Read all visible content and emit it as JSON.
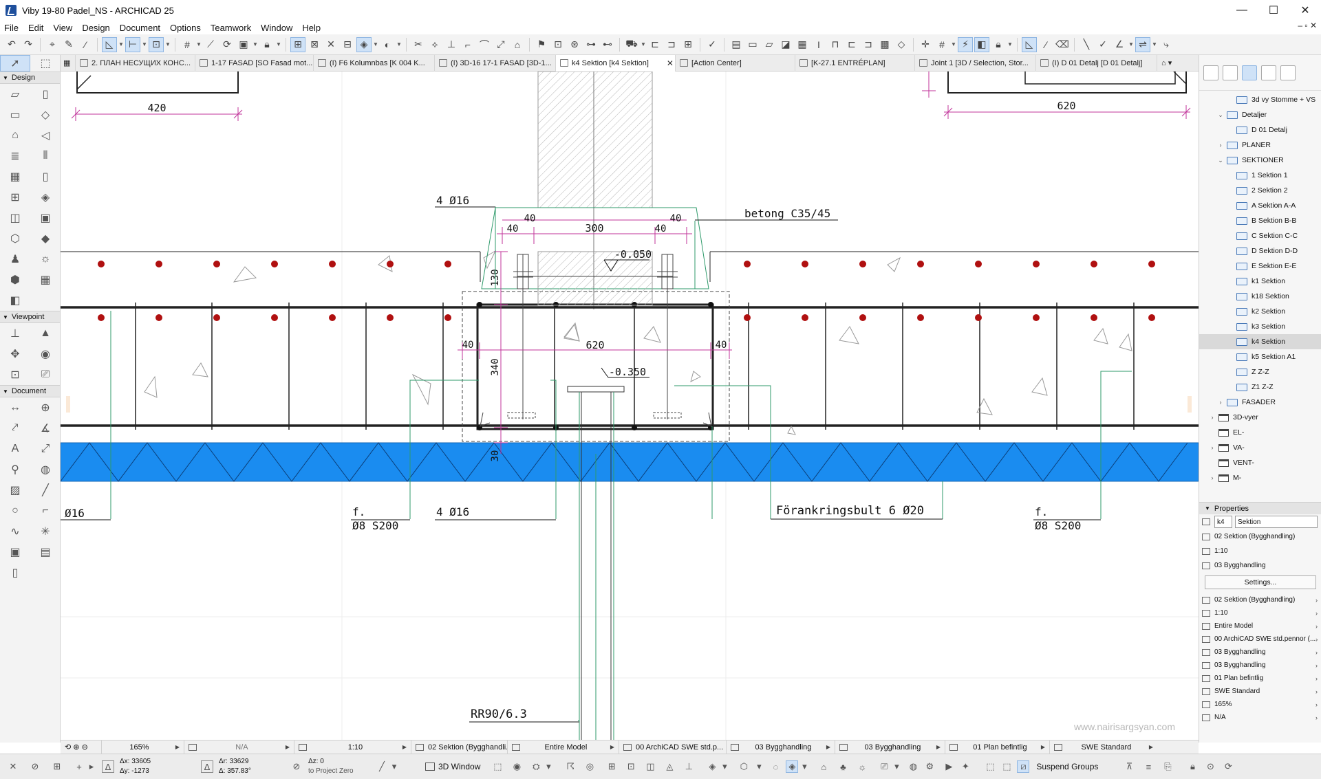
{
  "window": {
    "title": "Viby 19-80 Padel_NS - ARCHICAD 25",
    "minimize": "—",
    "maximize": "☐",
    "close": "✕"
  },
  "menu": [
    "File",
    "Edit",
    "View",
    "Design",
    "Document",
    "Options",
    "Teamwork",
    "Window",
    "Help"
  ],
  "toolbox": {
    "sections": {
      "design": "Design",
      "viewpoint": "Viewpoint",
      "document": "Document"
    }
  },
  "tabs": [
    {
      "label": "2. ПЛАН НЕСУЩИХ КОНС..."
    },
    {
      "label": "1-17 FASAD [SO Fasad mot..."
    },
    {
      "label": "(I) F6 Kolumnbas [K 004 K..."
    },
    {
      "label": "(I) 3D-16 17-1 FASAD [3D-1..."
    },
    {
      "label": "k4 Sektion [k4 Sektion]",
      "active": true
    },
    {
      "label": "[Action Center]"
    },
    {
      "label": "[K-27.1 ENTRÉPLAN]"
    },
    {
      "label": "Joint 1 [3D / Selection, Stor..."
    },
    {
      "label": "(I) D 01 Detalj [D 01 Detalj]"
    }
  ],
  "drawing": {
    "dims": {
      "d420": "420",
      "d620_top": "620",
      "d40_a": "40",
      "d40_b": "40",
      "d300": "300",
      "d40_c": "40",
      "d40_d": "40",
      "d130": "130",
      "d40_e": "40",
      "d620_mid": "620",
      "d40_f": "40",
      "d340": "340",
      "d30": "30"
    },
    "levels": {
      "top": "-0.050",
      "mid": "-0.350"
    },
    "labels": {
      "rebar_top": "4 Ø16",
      "concrete": "betong C35/45",
      "left_bar": "Ø16",
      "stirrup_left_1": "f.",
      "stirrup_left_2": "Ø8 S200",
      "rebar_bottom": "4 Ø16",
      "anchor": "Förankringsbult 6 Ø20",
      "stirrup_right_1": "f.",
      "stirrup_right_2": "Ø8 S200",
      "column": "RR90/6.3"
    },
    "watermark": "www.nairisargsyan.com",
    "colors": {
      "dimension": "#c0339a",
      "rebar_dot": "#b01010",
      "insulation": "#2288ee",
      "leader": "#2e9a6a"
    }
  },
  "navigator": {
    "tree": [
      {
        "label": "3d vy Stomme + VS",
        "type": "view",
        "indent": 1
      },
      {
        "label": "Detaljer",
        "type": "view",
        "indent": 0,
        "arrow": "⌄"
      },
      {
        "label": "D 01 Detalj",
        "type": "view",
        "indent": 1
      },
      {
        "label": "PLANER",
        "type": "view",
        "indent": 0,
        "arrow": "›"
      },
      {
        "label": "SEKTIONER",
        "type": "view",
        "indent": 0,
        "arrow": "⌄"
      },
      {
        "label": "1 Sektion 1",
        "type": "view",
        "indent": 1
      },
      {
        "label": "2 Sektion 2",
        "type": "view",
        "indent": 1
      },
      {
        "label": "A Sektion A-A",
        "type": "view",
        "indent": 1
      },
      {
        "label": "B Sektion B-B",
        "type": "view",
        "indent": 1
      },
      {
        "label": "C Sektion C-C",
        "type": "view",
        "indent": 1
      },
      {
        "label": "D Sektion D-D",
        "type": "view",
        "indent": 1
      },
      {
        "label": "E Sektion E-E",
        "type": "view",
        "indent": 1
      },
      {
        "label": "k1 Sektion",
        "type": "view",
        "indent": 1
      },
      {
        "label": "k18 Sektion",
        "type": "view",
        "indent": 1
      },
      {
        "label": "k2 Sektion",
        "type": "view",
        "indent": 1
      },
      {
        "label": "k3 Sektion",
        "type": "view",
        "indent": 1
      },
      {
        "label": "k4 Sektion",
        "type": "view",
        "indent": 1,
        "selected": true
      },
      {
        "label": "k5 Sektion A1",
        "type": "view",
        "indent": 1
      },
      {
        "label": "Z Z-Z",
        "type": "view",
        "indent": 1
      },
      {
        "label": "Z1 Z-Z",
        "type": "view",
        "indent": 1
      },
      {
        "label": "FASADER",
        "type": "view",
        "indent": 0,
        "arrow": "›"
      },
      {
        "label": "3D-vyer",
        "type": "folder",
        "indent": -1,
        "arrow": "›"
      },
      {
        "label": "EL-",
        "type": "folder",
        "indent": -1
      },
      {
        "label": "VA-",
        "type": "folder",
        "indent": -1,
        "arrow": "›"
      },
      {
        "label": "VENT-",
        "type": "folder",
        "indent": -1
      },
      {
        "label": "M-",
        "type": "folder",
        "indent": -1,
        "arrow": "›"
      }
    ],
    "properties": {
      "header": "Properties",
      "id_value": "k4",
      "name_value": "Sektion",
      "rows": [
        "02 Sektion (Bygghandling)",
        "1:10",
        "03 Bygghandling"
      ],
      "settings_label": "Settings...",
      "list": [
        "02 Sektion (Bygghandling)",
        "1:10",
        "Entire Model",
        "00 ArchiCAD SWE std.pennor (...",
        "03 Bygghandling",
        "03 Bygghandling",
        "01 Plan befintlig",
        "SWE Standard",
        "165%",
        "N/A"
      ]
    }
  },
  "quick_options": {
    "zoom": "165%",
    "angle": "N/A",
    "scale": "1:10",
    "layer_combo": "02 Sektion (Bygghandli...",
    "model_view": "Entire Model",
    "pen_set": "00 ArchiCAD SWE std.p...",
    "graphic_override": "03 Bygghandling",
    "dim_standard": "03 Bygghandling",
    "renovation": "01 Plan befintlig",
    "partial_structure": "SWE Standard"
  },
  "status": {
    "dx": "Δx: 33605",
    "dy": "Δy: -1273",
    "dr": "Δr: 33629",
    "da": "Δ: 357.83°",
    "dz": "Δz: 0",
    "to_project_zero": "to Project Zero",
    "window_3d": "3D Window",
    "suspend_groups": "Suspend Groups"
  }
}
